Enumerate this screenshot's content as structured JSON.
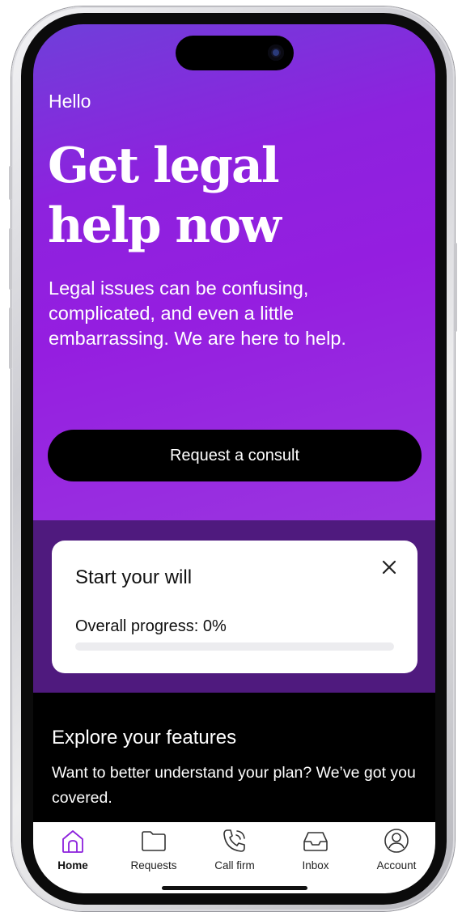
{
  "hero": {
    "greeting": "Hello",
    "headline_line1": "Get legal",
    "headline_line2": "help now",
    "subtext": "Legal issues can be confusing, complicated, and even a little embarrassing. We are here to help.",
    "cta_label": "Request a consult"
  },
  "will_card": {
    "title": "Start your will",
    "progress_label": "Overall progress: 0%",
    "progress_value": 0
  },
  "features": {
    "title": "Explore your features",
    "text": "Want to better understand your plan? We’ve got you covered."
  },
  "tabbar": {
    "tabs": [
      {
        "label": "Home",
        "icon": "home-icon",
        "active": true
      },
      {
        "label": "Requests",
        "icon": "folder-icon",
        "active": false
      },
      {
        "label": "Call firm",
        "icon": "phone-icon",
        "active": false
      },
      {
        "label": "Inbox",
        "icon": "inbox-icon",
        "active": false
      },
      {
        "label": "Account",
        "icon": "account-icon",
        "active": false
      }
    ]
  },
  "colors": {
    "accent": "#8c20dc",
    "band": "#4f1a7e",
    "cta_background": "#000000"
  }
}
